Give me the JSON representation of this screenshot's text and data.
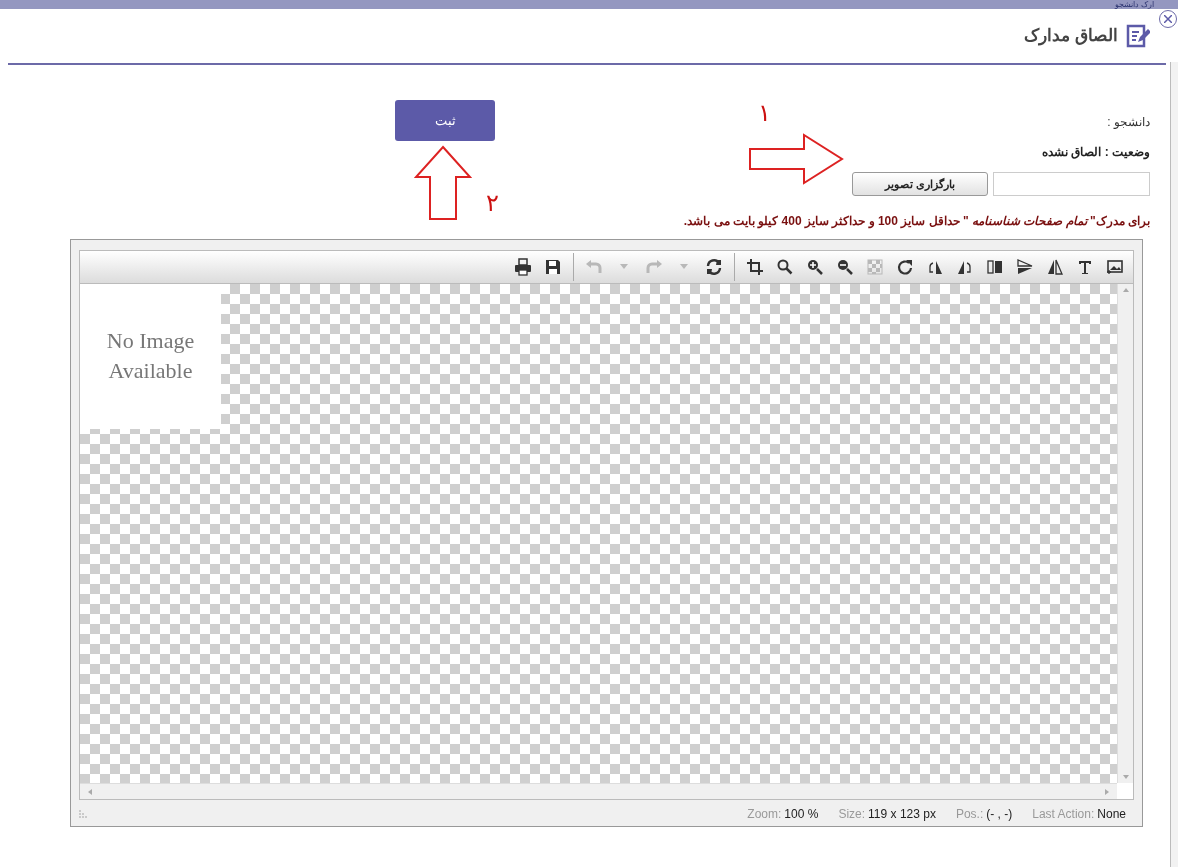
{
  "background_title": "ارک دانشجو",
  "dialog": {
    "title": "الصاق مدارک"
  },
  "form": {
    "student_label": "دانشجو :",
    "status": "وضعیت : الصاق نشده",
    "upload_button": "بارگزاری تصویر",
    "note": "برای مدرک\" *تمام صفحات شناسنامه* \" حداقل سایز **100** و حداکثر سایز **400** کیلو بایت می باشد.",
    "submit_button": "ثبت"
  },
  "annotations": [
    {
      "kind": "right-arrow",
      "number": "۱"
    },
    {
      "kind": "up-arrow",
      "number": "۲"
    }
  ],
  "editor": {
    "toolbar": [
      {
        "kind": "add-image",
        "disabled": false
      },
      {
        "kind": "text",
        "disabled": false
      },
      {
        "kind": "flip-h",
        "disabled": false
      },
      {
        "kind": "flip-v",
        "disabled": false
      },
      {
        "kind": "split",
        "disabled": false
      },
      {
        "kind": "rotate-left-flip",
        "disabled": false
      },
      {
        "kind": "rotate-right-flip",
        "disabled": false
      },
      {
        "kind": "rotate",
        "disabled": false
      },
      {
        "kind": "checker",
        "disabled": true
      },
      {
        "kind": "zoom-out",
        "disabled": false
      },
      {
        "kind": "zoom-in",
        "disabled": false
      },
      {
        "kind": "zoom",
        "disabled": false
      },
      {
        "kind": "crop",
        "disabled": false
      },
      {
        "kind": "separator"
      },
      {
        "kind": "reload",
        "disabled": false
      },
      {
        "kind": "caret",
        "disabled": true
      },
      {
        "kind": "redo",
        "disabled": true
      },
      {
        "kind": "caret",
        "disabled": true
      },
      {
        "kind": "undo",
        "disabled": true
      },
      {
        "kind": "separator"
      },
      {
        "kind": "save",
        "disabled": false
      },
      {
        "kind": "print",
        "disabled": false
      }
    ],
    "placeholder_image": "No Image Available",
    "status": {
      "zoom": {
        "caption": "Zoom:",
        "reading": "100 %"
      },
      "size": {
        "caption": "Size:",
        "reading": "119 x 123 px"
      },
      "position": {
        "caption": "Pos.:",
        "reading": "(- , -)"
      },
      "last_action": {
        "caption": "Last Action:",
        "reading": "None"
      }
    }
  }
}
